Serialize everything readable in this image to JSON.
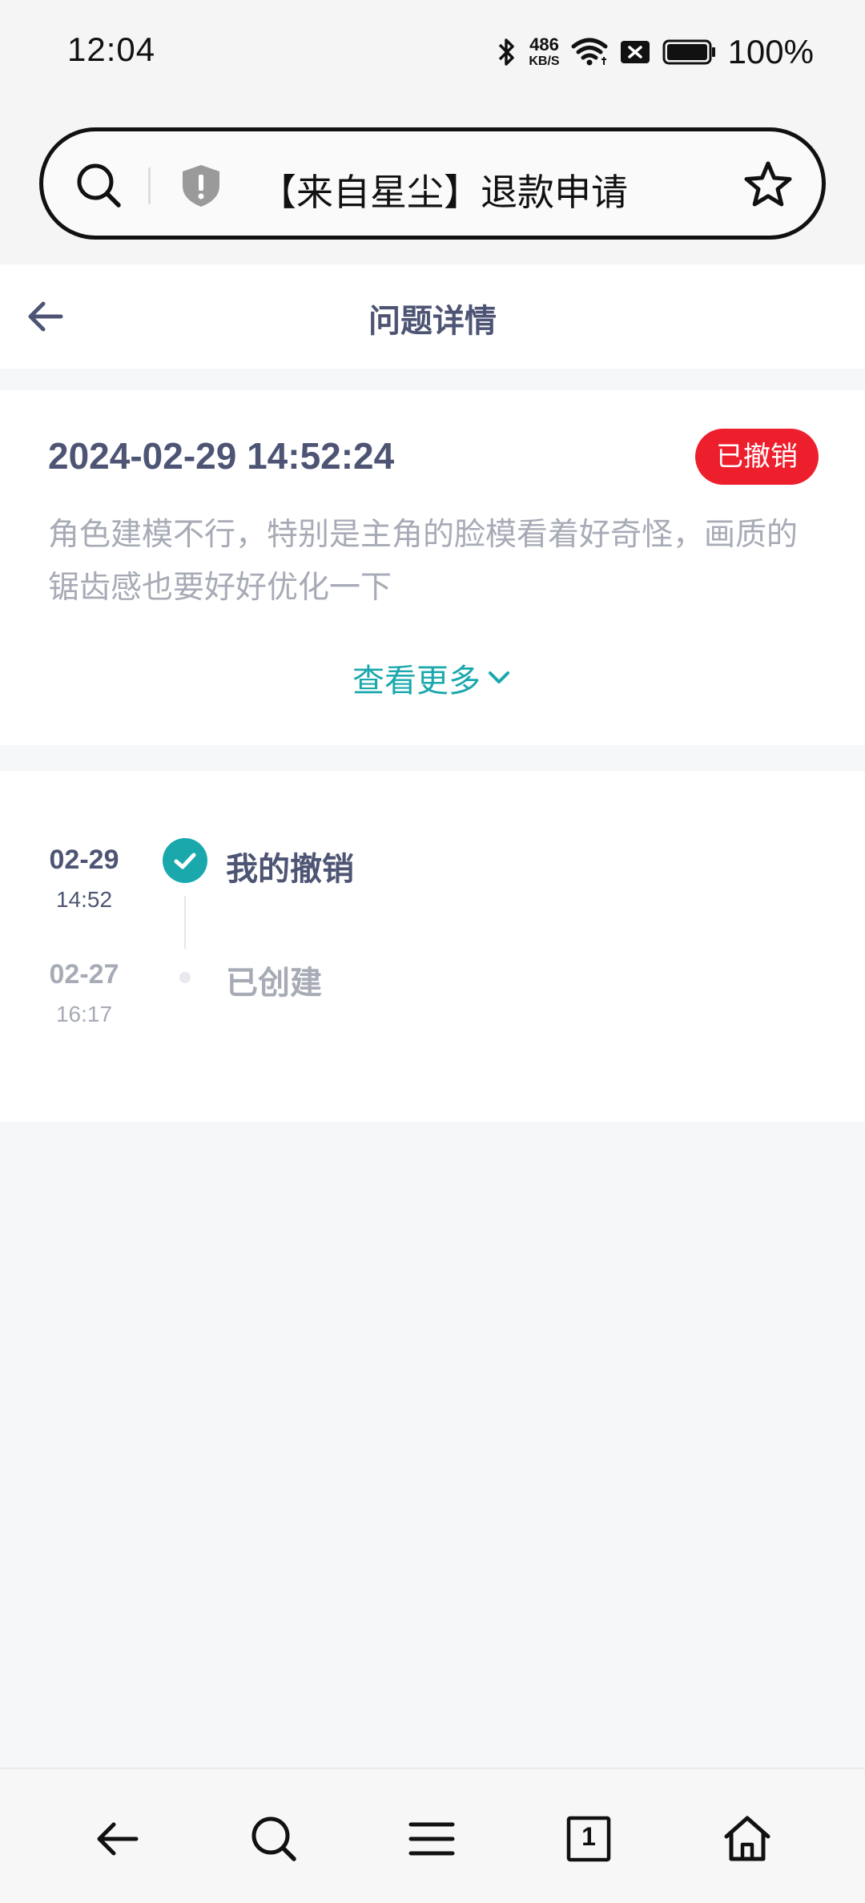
{
  "status_bar": {
    "time": "12:04",
    "net_speed_value": "486",
    "net_speed_unit": "KB/S",
    "battery": "100%"
  },
  "address_bar": {
    "text": "【来自星尘】退款申请"
  },
  "header": {
    "title": "问题详情"
  },
  "ticket": {
    "datetime": "2024-02-29 14:52:24",
    "status": "已撤销",
    "description": "角色建模不行，特别是主角的脸模看着好奇怪，画质的锯齿感也要好好优化一下",
    "see_more": "查看更多"
  },
  "timeline": [
    {
      "date": "02-29",
      "time": "14:52",
      "title": "我的撤销",
      "active": true
    },
    {
      "date": "02-27",
      "time": "16:17",
      "title": "已创建",
      "active": false
    }
  ],
  "bottom_nav": {
    "tab_count": "1",
    "items": [
      "back-icon",
      "search-icon",
      "menu-icon",
      "tabs-icon",
      "home-icon"
    ]
  },
  "colors": {
    "accent": "#1aa8ad",
    "badge_red": "#ee1f2c",
    "title_text": "#4e5574",
    "muted_text": "#a7abb6"
  }
}
